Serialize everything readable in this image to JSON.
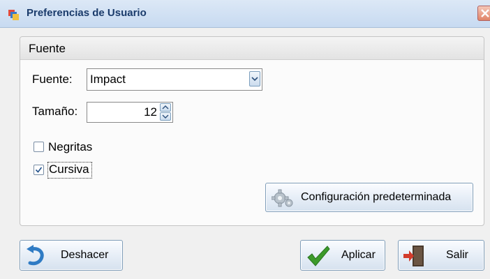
{
  "window": {
    "title": "Preferencias de Usuario",
    "app_icon": "app-window-icon",
    "close_icon": "close-icon"
  },
  "font_group": {
    "title": "Fuente",
    "font_label": "Fuente:",
    "font_value": "Impact",
    "size_label": "Tamaño:",
    "size_value": "12",
    "bold": {
      "label": "Negritas",
      "checked": false
    },
    "italic": {
      "label": "Cursiva",
      "checked": true
    },
    "defaults_button": {
      "label": "Configuración predeterminada",
      "icon": "gear-icon"
    }
  },
  "footer": {
    "undo_button": {
      "label": "Deshacer",
      "icon": "undo-arrow-icon"
    },
    "apply_button": {
      "label": "Aplicar",
      "icon": "checkmark-icon"
    },
    "exit_button": {
      "label": "Salir",
      "icon": "exit-door-icon"
    }
  },
  "colors": {
    "titlebar": "#c7daf1",
    "title_text": "#1a3b6b",
    "button_border": "#7f9db9",
    "check_green": "#3c9a2a",
    "undo_blue": "#2f7bc4",
    "exit_red": "#d23b2b"
  }
}
